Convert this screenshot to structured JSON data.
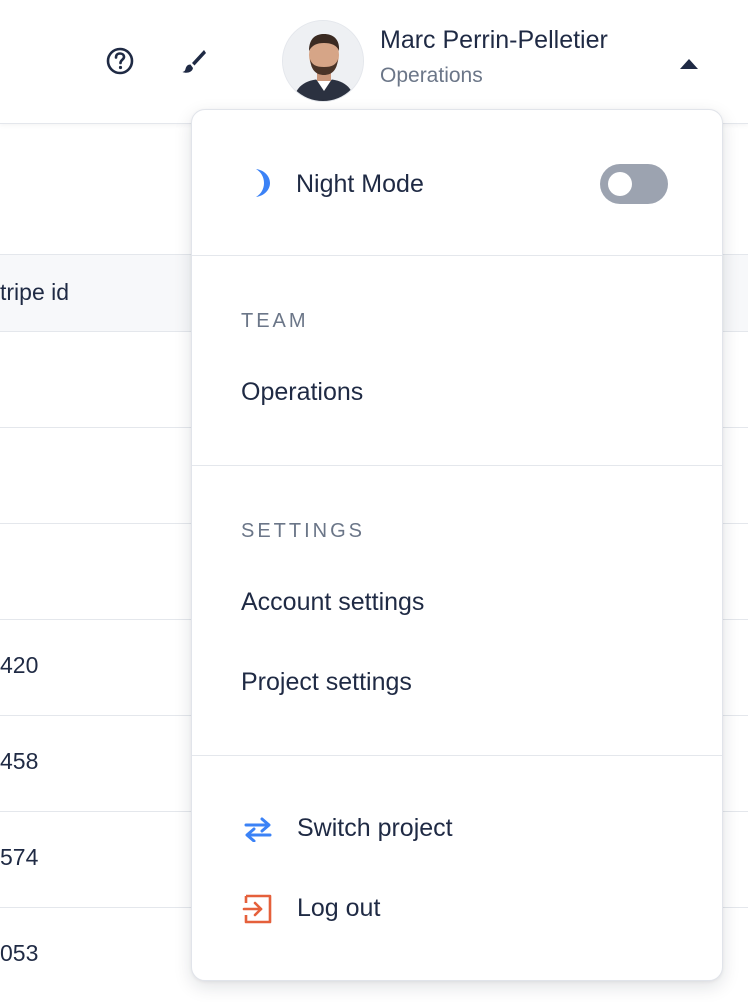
{
  "header": {
    "user": {
      "name": "Marc Perrin-Pelletier",
      "team": "Operations"
    },
    "icons": [
      "help-icon",
      "brush-icon",
      "caret-up-icon"
    ]
  },
  "table": {
    "columns": [
      "tripe id"
    ],
    "rows": [
      "",
      "",
      "",
      "420",
      "458",
      "574",
      "053"
    ]
  },
  "dropdown": {
    "night_mode": {
      "label": "Night Mode",
      "enabled": false,
      "icon": "moon-icon"
    },
    "team": {
      "title": "TEAM",
      "items": [
        "Operations"
      ]
    },
    "settings": {
      "title": "SETTINGS",
      "items": [
        "Account settings",
        "Project settings"
      ]
    },
    "actions": [
      {
        "label": "Switch project",
        "icon": "switch-arrows-icon"
      },
      {
        "label": "Log out",
        "icon": "logout-icon"
      }
    ]
  },
  "colors": {
    "accent_blue": "#3b82f6",
    "logout_orange": "#e5603b",
    "text_primary": "#1f2a44",
    "text_muted": "#6b7688",
    "toggle_off": "#9ca3b0"
  }
}
